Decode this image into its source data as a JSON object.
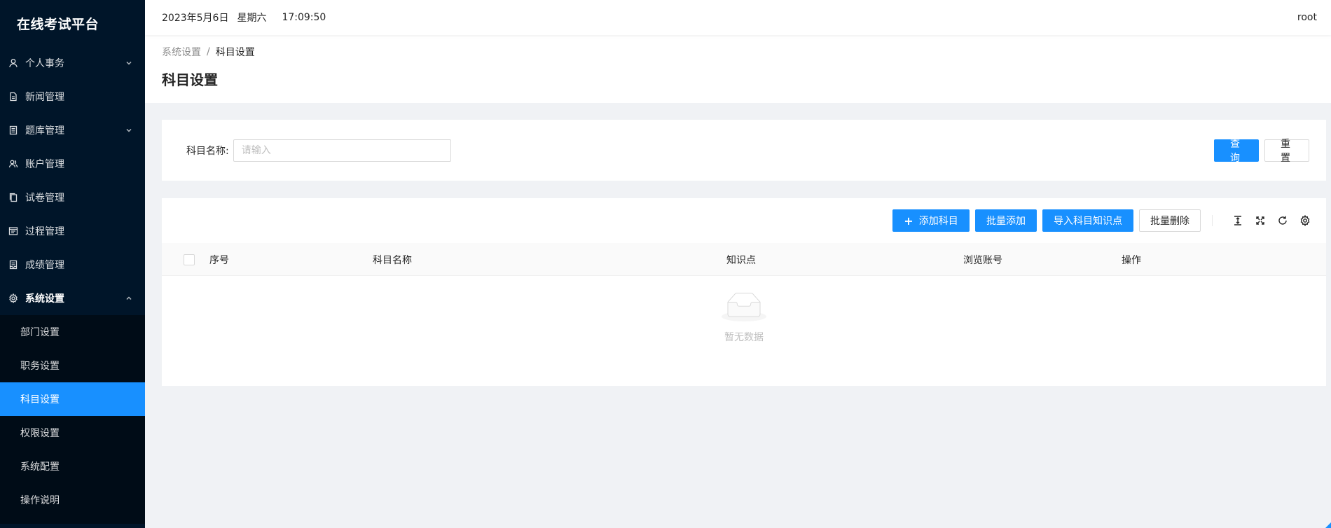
{
  "app": {
    "title": "在线考试平台"
  },
  "sidebar": {
    "items": [
      {
        "label": "个人事务",
        "icon": "user-icon",
        "has_arrow": true,
        "arrow": "down"
      },
      {
        "label": "新闻管理",
        "icon": "file-icon",
        "has_arrow": false
      },
      {
        "label": "题库管理",
        "icon": "book-icon",
        "has_arrow": true,
        "arrow": "down"
      },
      {
        "label": "账户管理",
        "icon": "users-icon",
        "has_arrow": false
      },
      {
        "label": "试卷管理",
        "icon": "copy-icon",
        "has_arrow": false
      },
      {
        "label": "过程管理",
        "icon": "profile-icon",
        "has_arrow": false
      },
      {
        "label": "成绩管理",
        "icon": "container-icon",
        "has_arrow": false
      },
      {
        "label": "系统设置",
        "icon": "gear-icon",
        "has_arrow": true,
        "arrow": "up",
        "open": true
      }
    ],
    "submenu": [
      {
        "label": "部门设置"
      },
      {
        "label": "职务设置"
      },
      {
        "label": "科目设置",
        "active": true
      },
      {
        "label": "权限设置"
      },
      {
        "label": "系统配置"
      },
      {
        "label": "操作说明"
      }
    ]
  },
  "header": {
    "date": "2023年5月6日",
    "weekday": "星期六",
    "time": "17:09:50",
    "user": "root"
  },
  "breadcrumb": {
    "parent": "系统设置",
    "separator": "/",
    "current": "科目设置"
  },
  "page": {
    "title": "科目设置"
  },
  "search": {
    "label": "科目名称:",
    "placeholder": "请输入",
    "value": "",
    "query_label": "查询",
    "reset_label": "重置"
  },
  "toolbar": {
    "add_label": "添加科目",
    "batch_add_label": "批量添加",
    "import_label": "导入科目知识点",
    "batch_delete_label": "批量删除"
  },
  "table": {
    "columns": [
      "序号",
      "科目名称",
      "知识点",
      "浏览账号",
      "操作"
    ],
    "rows": [],
    "empty_text": "暂无数据"
  },
  "colors": {
    "sidebar_bg": "#001529",
    "submenu_bg": "#000c17",
    "primary": "#1890ff",
    "page_bg": "#f0f2f5"
  }
}
